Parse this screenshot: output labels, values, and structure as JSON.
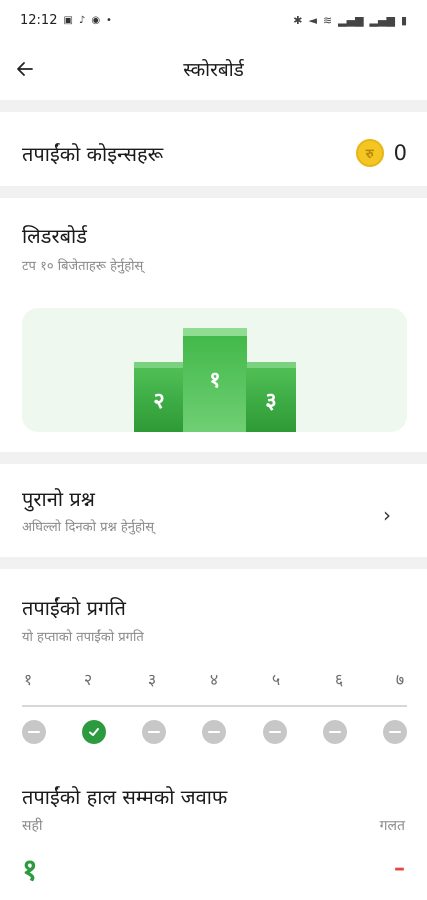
{
  "status_bar": {
    "time": "12:12",
    "left_icons": [
      "gallery-icon",
      "music-icon",
      "whatsapp-icon",
      "dot-icon"
    ],
    "right_icons": [
      "bluetooth-icon",
      "mute-icon",
      "wifi-icon",
      "signal-icon",
      "signal-icon",
      "battery-icon"
    ]
  },
  "app_bar": {
    "title": "स्कोरबोर्ड"
  },
  "coins": {
    "label": "तपाईंको कोइन्सहरू",
    "value": "0",
    "coin_symbol": "रु"
  },
  "leaderboard": {
    "title": "लिडरबोर्ड",
    "subtitle": "टप १० बिजेताहरू हेर्नुहोस्",
    "podium": {
      "first": "१",
      "second": "२",
      "third": "३"
    }
  },
  "previous_question": {
    "title": "पुरानो प्रश्न",
    "subtitle": "अघिल्लो दिनको प्रश्न हेर्नुहोस्",
    "chevron": "›"
  },
  "progress": {
    "title": "तपाईंको प्रगति",
    "subtitle": "यो हप्ताको तपाईंको प्रगति",
    "days": [
      {
        "label": "१",
        "done": false
      },
      {
        "label": "२",
        "done": true
      },
      {
        "label": "३",
        "done": false
      },
      {
        "label": "४",
        "done": false
      },
      {
        "label": "५",
        "done": false
      },
      {
        "label": "६",
        "done": false
      },
      {
        "label": "७",
        "done": false
      }
    ]
  },
  "answers": {
    "title": "तपाईंको हाल सम्मको जवाफ",
    "correct_label": "सही",
    "wrong_label": "गलत",
    "correct_value": "१",
    "wrong_value": "–"
  },
  "colors": {
    "accent_green": "#2c9b3f",
    "coin_gold": "#f3c622",
    "wrong_red": "#e04848"
  }
}
